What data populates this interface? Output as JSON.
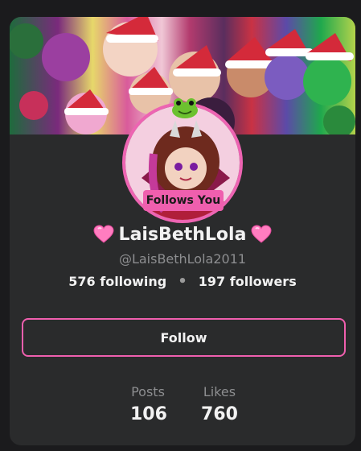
{
  "profile": {
    "follows_badge": "Follows You",
    "display_name": "LaisBethLola",
    "handle": "@LaisBethLola2011",
    "following": "576 following",
    "separator": "•",
    "followers": "197 followers",
    "follow_button": "Follow",
    "stats": {
      "posts_label": "Posts",
      "posts_value": "106",
      "likes_label": "Likes",
      "likes_value": "760"
    }
  },
  "colors": {
    "accent_pink": "#ef5fae",
    "card_bg": "#2a2b2c",
    "text_primary": "#f2f2f2",
    "text_muted": "#8d8e90"
  },
  "icons": {
    "name_prefix": "pink-heart-icon",
    "name_suffix": "pink-heart-icon",
    "avatar_decoration": "frog-icon"
  }
}
